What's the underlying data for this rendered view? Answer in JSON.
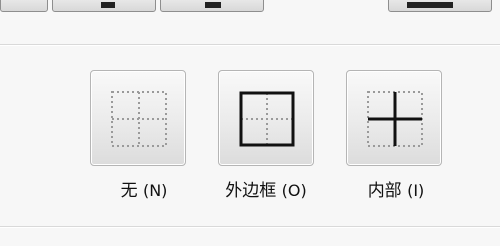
{
  "border_options": [
    {
      "label": "无",
      "accelerator": "(N)"
    },
    {
      "label": "外边框",
      "accelerator": "(O)"
    },
    {
      "label": "内部",
      "accelerator": "(I)"
    }
  ],
  "colors": {
    "background": "#f7f7f7",
    "button_border": "#b5b5b5",
    "line_solid": "#111111",
    "line_dotted": "#9a9a9a"
  },
  "icons": [
    "no-border-icon",
    "outline-border-icon",
    "inside-border-icon"
  ]
}
